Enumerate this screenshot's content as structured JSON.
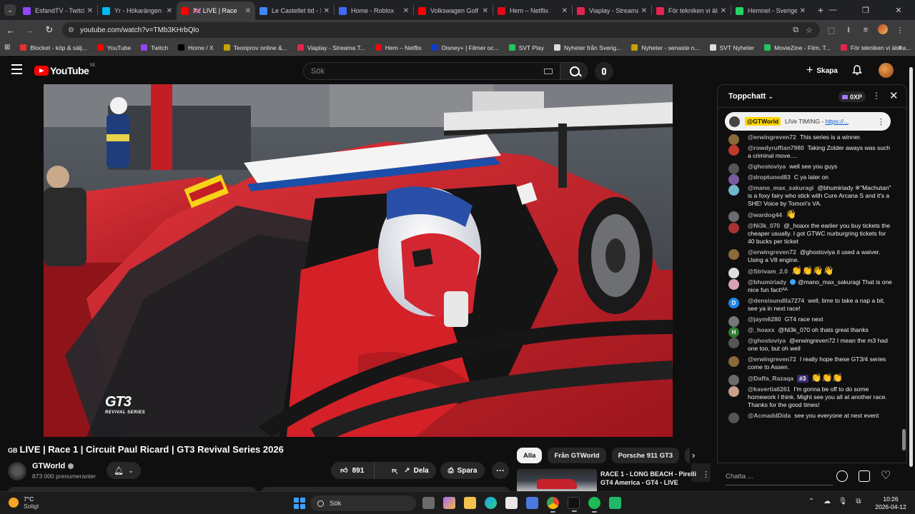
{
  "browser": {
    "tabs": [
      {
        "label": "EsfandTV - Twitch",
        "color": "#9146ff",
        "active": false
      },
      {
        "label": "Yr - Hökarängen",
        "color": "#00b9f1",
        "active": false
      },
      {
        "label": "🇬🇧 LIVE | Race",
        "color": "#ff0000",
        "active": true
      },
      {
        "label": "Le Castellet tid - S",
        "color": "#4285f4",
        "active": false
      },
      {
        "label": "Home - Roblox",
        "color": "#3d6bf5",
        "active": false
      },
      {
        "label": "Volkswagen Golf -",
        "color": "#ff0000",
        "active": false
      },
      {
        "label": "Hem – Netflix",
        "color": "#e50914",
        "active": false
      },
      {
        "label": "Viaplay - Streama",
        "color": "#e4244f",
        "active": false
      },
      {
        "label": "För tekniken vi äls",
        "color": "#e4244f",
        "active": false
      },
      {
        "label": "Hemnet - Sverige",
        "color": "#25d366",
        "active": false
      }
    ],
    "url": "youtube.com/watch?v=TMb3KHrbQlo",
    "bookmarks": [
      {
        "label": "Blocket - köp & sälj...",
        "color": "#e8312f"
      },
      {
        "label": "YouTube",
        "color": "#ff0000"
      },
      {
        "label": "Twitch",
        "color": "#9146ff"
      },
      {
        "label": "Home / X",
        "color": "#000000"
      },
      {
        "label": "Teoriprov online &...",
        "color": "#c6a300"
      },
      {
        "label": "Viaplay - Streama T...",
        "color": "#e4244f"
      },
      {
        "label": "Hem – Netflix",
        "color": "#e50914"
      },
      {
        "label": "Disney+ | Filmer oc...",
        "color": "#113ccf"
      },
      {
        "label": "SVT Play",
        "color": "#22c55e"
      },
      {
        "label": "Nyheter från Sverig...",
        "color": "#dddddd"
      },
      {
        "label": "Nyheter - senaste n...",
        "color": "#c6a300"
      },
      {
        "label": "SVT Nyheter",
        "color": "#dddddd"
      },
      {
        "label": "MovieZine - Film, T...",
        "color": "#22c55e"
      },
      {
        "label": "För tekniken vi älska...",
        "color": "#e4244f"
      }
    ]
  },
  "youtube": {
    "logo": "YouTube",
    "region": "SE",
    "search_placeholder": "Sök",
    "create_label": "Skapa"
  },
  "video": {
    "flag": "GB",
    "title": "LIVE | Race 1 | Circuit Paul Ricard | GT3 Revival Series 2026",
    "overlay_logo": "GT3",
    "overlay_sub": "REVIVAL SERIES",
    "channel": "GTWorld",
    "subscribers": "873 000 prenumeranter",
    "likes": "891",
    "share_label": "Dela",
    "save_label": "Spara",
    "more_label": "···"
  },
  "recommendations": {
    "chips": [
      "Alla",
      "Från GTWorld",
      "Porsche 911 GT3",
      "BM"
    ],
    "items": [
      {
        "title": "RACE 1 - LONG BEACH - Pirelli GT4 America - GT4 - LIVE"
      }
    ]
  },
  "chat": {
    "mode": "Toppchatt",
    "xp": "0XP",
    "pinned": {
      "author": "@GTWorld",
      "text": "LIVe TIMING - ",
      "link": "https://..."
    },
    "messages": [
      {
        "author": "@erwingreven72",
        "text": "This series is a winner.",
        "color": "#8a6a3a"
      },
      {
        "author": "@rowdyruffian7980",
        "text": "Taking Zolder aways was such a criminal move....",
        "color": "#c0392b"
      },
      {
        "author": "@ghostoviya",
        "text": "well see you guys",
        "color": "#555555"
      },
      {
        "author": "@droptuned83",
        "text": "C ya later on",
        "color": "#7a5c9e"
      },
      {
        "author": "@mano_max_sakuragi",
        "text": "@bhumiriady ※\"Machutan\" is a foxy fairy who stick with Cure Arcana S and it's a SHE! Voice by Tomori's VA.",
        "color": "#6fb8c9"
      },
      {
        "author": "@wardog44",
        "text": "👋",
        "color": "#6b6b6b"
      },
      {
        "author": "@Ni3k_070",
        "text": "@_hoaxx the earlier you buy tickets the cheaper usually. I got GTWC nurburgring tickets for 40 bucks per ticket",
        "color": "#a83232"
      },
      {
        "author": "@erwingreven72",
        "text": "@ghostoviya it used a waiver. Using a V8 engine.",
        "color": "#8a6a3a"
      },
      {
        "author": "@Strivam_2.0",
        "text": "👏👏👋👋",
        "color": "#dddddd"
      },
      {
        "author": "@bhumiriady",
        "text": "@mano_max_sakuragi That is one nice fun fact!ᴬᴬ",
        "color": "#d9a3b5",
        "verified": true
      },
      {
        "author": "@densisundlla7274",
        "text": "well, time to take a nap a bit, see ya in next race!",
        "color": "#1e88e5",
        "initial": "D"
      },
      {
        "author": "@jaym6280",
        "text": "GT4 race next",
        "color": "#777777"
      },
      {
        "author": "@_hoaxx",
        "text": "@Ni3k_070 oh thats great thanks",
        "color": "#2e7d32",
        "initial": "H"
      },
      {
        "author": "@ghostoviya",
        "text": "@erwingreven72 I mean the m3 had one too, but oh well",
        "color": "#555555"
      },
      {
        "author": "@erwingreven72",
        "text": "I really hope these GT3/4 series come to Assen.",
        "color": "#8a6a3a"
      },
      {
        "author": "@Daffa_Razaqa",
        "text": "👏👏👏",
        "color": "#6b6b6b",
        "member": "#3"
      },
      {
        "author": "@kavertia6261",
        "text": "I'm gonna be off to do some homework I think. Might see you all at another race. Thanks for the good times!",
        "color": "#c9a08a"
      },
      {
        "author": "@AcmaddDida",
        "text": "see you everyone at next event",
        "color": "#555555"
      }
    ],
    "input_placeholder": "Chatta ..."
  },
  "taskbar": {
    "temp": "7°C",
    "weather": "Soligt",
    "search_label": "Sök",
    "time": "10:26",
    "date": "2026-04-12"
  }
}
